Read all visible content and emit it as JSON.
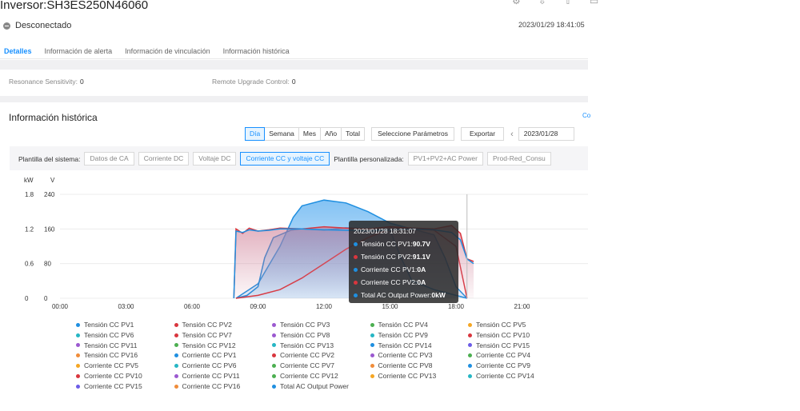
{
  "header": {
    "title": "Inversor:SH3ES250N46060",
    "status": "Desconectado",
    "timestamp": "2023/01/29 18:41:05"
  },
  "tabs": [
    "Detalles",
    "Información de alerta",
    "Información de vinculación",
    "Información histórica"
  ],
  "params": {
    "resonance_label": "Resonance Sensitivity:",
    "resonance_value": "0",
    "upgrade_label": "Remote Upgrade Control:",
    "upgrade_value": "0"
  },
  "history": {
    "title": "Información histórica",
    "link": "Co",
    "periods": [
      "Día",
      "Semana",
      "Mes",
      "Año",
      "Total"
    ],
    "active_period": "Día",
    "select_params": "Seleccione Parámetros",
    "export": "Exportar",
    "prev_icon": "chevron-left-icon",
    "date": "2023/01/28"
  },
  "templates": {
    "system_label": "Plantilla del sistema:",
    "system": [
      "Datos de CA",
      "Corriente DC",
      "Voltaje DC",
      "Corriente CC y voltaje CC"
    ],
    "active": "Corriente CC y voltaje CC",
    "custom_label": "Plantilla personalizada:",
    "custom": [
      "PV1+PV2+AC Power",
      "Prod-Red_Consu"
    ]
  },
  "tooltip": {
    "time": "2023/01/28 18:31:07",
    "rows": [
      {
        "label": "Tensión CC PV1:",
        "value": "90.7V",
        "color": "#1f8fe0"
      },
      {
        "label": "Tensión CC PV2:",
        "value": "91.1V",
        "color": "#d9363e"
      },
      {
        "label": "Corriente CC PV1:",
        "value": "0A",
        "color": "#1f8fe0"
      },
      {
        "label": "Corriente CC PV2:",
        "value": "0A",
        "color": "#d9363e"
      },
      {
        "label": "Total AC Output Power:",
        "value": "0kW",
        "color": "#1f8fe0"
      }
    ]
  },
  "legend": [
    {
      "label": "Tensión CC PV1",
      "color": "#1f8fe0"
    },
    {
      "label": "Tensión CC PV2",
      "color": "#d9363e"
    },
    {
      "label": "Tensión CC PV3",
      "color": "#9b59d0"
    },
    {
      "label": "Tensión CC PV4",
      "color": "#4caf50"
    },
    {
      "label": "Tensión CC PV5",
      "color": "#f5a623"
    },
    {
      "label": "Tensión CC PV6",
      "color": "#26b6c4"
    },
    {
      "label": "Tensión CC PV7",
      "color": "#d9363e"
    },
    {
      "label": "Tensión CC PV8",
      "color": "#9b59d0"
    },
    {
      "label": "Tensión CC PV9",
      "color": "#26b6c4"
    },
    {
      "label": "Tensión CC PV10",
      "color": "#d9363e"
    },
    {
      "label": "Tensión CC PV11",
      "color": "#9b59d0"
    },
    {
      "label": "Tensión CC PV12",
      "color": "#4caf50"
    },
    {
      "label": "Tensión CC PV13",
      "color": "#26b6c4"
    },
    {
      "label": "Tensión CC PV14",
      "color": "#1f8fe0"
    },
    {
      "label": "Tensión CC PV15",
      "color": "#6c5ce7"
    },
    {
      "label": "Tensión CC PV16",
      "color": "#f08c3a"
    },
    {
      "label": "Corriente CC PV1",
      "color": "#1f8fe0"
    },
    {
      "label": "Corriente CC PV2",
      "color": "#d9363e"
    },
    {
      "label": "Corriente CC PV3",
      "color": "#9b59d0"
    },
    {
      "label": "Corriente CC PV4",
      "color": "#4caf50"
    },
    {
      "label": "Corriente CC PV5",
      "color": "#f5a623"
    },
    {
      "label": "Corriente CC PV6",
      "color": "#26b6c4"
    },
    {
      "label": "Corriente CC PV7",
      "color": "#4caf50"
    },
    {
      "label": "Corriente CC PV8",
      "color": "#f08c3a"
    },
    {
      "label": "Corriente CC PV9",
      "color": "#1f8fe0"
    },
    {
      "label": "Corriente CC PV10",
      "color": "#d9363e"
    },
    {
      "label": "Corriente CC PV11",
      "color": "#9b59d0"
    },
    {
      "label": "Corriente CC PV12",
      "color": "#4caf50"
    },
    {
      "label": "Corriente CC PV13",
      "color": "#f5a623"
    },
    {
      "label": "Corriente CC PV14",
      "color": "#26b6c4"
    },
    {
      "label": "Corriente CC PV15",
      "color": "#6c5ce7"
    },
    {
      "label": "Corriente CC PV16",
      "color": "#f08c3a"
    },
    {
      "label": "Total AC Output Power",
      "color": "#1f8fe0"
    }
  ],
  "chart_data": {
    "type": "line",
    "y_left_unit": "kW",
    "y_right_unit": "V",
    "y_left_ticks": [
      "1.8",
      "1.2",
      "0.6",
      "0"
    ],
    "y_right_ticks": [
      "240",
      "160",
      "80",
      "0"
    ],
    "ylim_left": [
      0,
      1.8
    ],
    "ylim_right": [
      0,
      240
    ],
    "x_ticks": [
      "00:00",
      "03:00",
      "06:00",
      "09:00",
      "12:00",
      "15:00",
      "18:00",
      "21:00"
    ],
    "xlim_hours": [
      0,
      24
    ],
    "series": [
      {
        "name": "Tensión CC PV1",
        "axis": "right",
        "color": "#1f8fe0",
        "points": [
          [
            7.9,
            0
          ],
          [
            8.0,
            155
          ],
          [
            8.3,
            152
          ],
          [
            8.6,
            158
          ],
          [
            9.0,
            155
          ],
          [
            9.5,
            157
          ],
          [
            10.0,
            160
          ],
          [
            11.0,
            160
          ],
          [
            12.0,
            158
          ],
          [
            13.0,
            157
          ],
          [
            14.0,
            155
          ],
          [
            15.0,
            158
          ],
          [
            16.0,
            160
          ],
          [
            17.0,
            158
          ],
          [
            17.8,
            152
          ],
          [
            18.2,
            135
          ],
          [
            18.5,
            90.7
          ],
          [
            18.8,
            80
          ]
        ]
      },
      {
        "name": "Tensión CC PV2",
        "axis": "right",
        "color": "#d9363e",
        "points": [
          [
            7.9,
            0
          ],
          [
            8.0,
            160
          ],
          [
            8.3,
            150
          ],
          [
            8.6,
            162
          ],
          [
            9.0,
            155
          ],
          [
            9.5,
            158
          ],
          [
            10.0,
            162
          ],
          [
            11.0,
            160
          ],
          [
            12.0,
            165
          ],
          [
            13.0,
            162
          ],
          [
            14.0,
            160
          ],
          [
            15.0,
            165
          ],
          [
            16.0,
            162
          ],
          [
            17.0,
            160
          ],
          [
            17.8,
            168
          ],
          [
            18.2,
            150
          ],
          [
            18.5,
            91.1
          ],
          [
            18.8,
            85
          ]
        ]
      },
      {
        "name": "Corriente CC PV1",
        "axis": "left",
        "color": "#1f8fe0",
        "points": [
          [
            8.0,
            0
          ],
          [
            8.5,
            0.05
          ],
          [
            9.0,
            0.2
          ],
          [
            9.3,
            0.7
          ],
          [
            9.7,
            1.05
          ],
          [
            10.5,
            1.18
          ],
          [
            11.0,
            1.2
          ],
          [
            12.0,
            1.18
          ],
          [
            13.0,
            1.22
          ],
          [
            14.0,
            1.2
          ],
          [
            15.0,
            1.18
          ],
          [
            15.5,
            0.7
          ],
          [
            16.0,
            0.3
          ],
          [
            17.0,
            0.15
          ],
          [
            18.0,
            0.05
          ],
          [
            18.5,
            0
          ]
        ]
      },
      {
        "name": "Corriente CC PV2",
        "axis": "left",
        "color": "#d9363e",
        "points": [
          [
            8.0,
            0
          ],
          [
            9.0,
            0.05
          ],
          [
            10.0,
            0.15
          ],
          [
            11.0,
            0.35
          ],
          [
            12.0,
            0.6
          ],
          [
            13.0,
            0.85
          ],
          [
            14.0,
            1.05
          ],
          [
            15.0,
            1.2
          ],
          [
            16.0,
            1.2
          ],
          [
            17.0,
            1.18
          ],
          [
            18.0,
            0.9
          ],
          [
            18.5,
            0
          ]
        ]
      },
      {
        "name": "Total AC Output Power",
        "axis": "left",
        "color": "#1f8fe0",
        "points": [
          [
            8.0,
            0
          ],
          [
            9.0,
            0.25
          ],
          [
            10.0,
            0.9
          ],
          [
            10.6,
            1.4
          ],
          [
            11.0,
            1.6
          ],
          [
            12.0,
            1.7
          ],
          [
            13.0,
            1.65
          ],
          [
            14.0,
            1.5
          ],
          [
            15.0,
            1.3
          ],
          [
            16.0,
            1.2
          ],
          [
            17.0,
            1.1
          ],
          [
            17.5,
            0.7
          ],
          [
            18.0,
            0.2
          ],
          [
            18.5,
            0
          ]
        ]
      }
    ],
    "cursor_hour": 18.5
  }
}
